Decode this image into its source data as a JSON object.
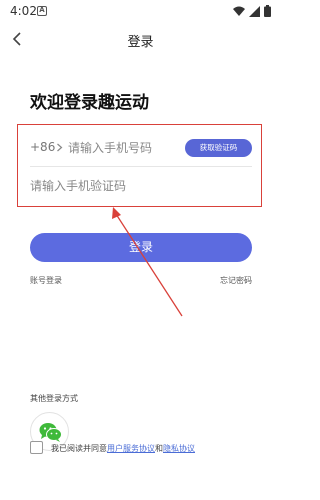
{
  "status_bar": {
    "time": "4:02",
    "notification_letter": "A",
    "icons": [
      "wifi-icon",
      "signal-icon",
      "battery-icon"
    ]
  },
  "nav": {
    "title": "登录",
    "back_icon": "chevron-left-icon"
  },
  "welcome_title": "欢迎登录趣运动",
  "phone_field": {
    "country_code": "+86",
    "placeholder": "请输入手机号码",
    "value": ""
  },
  "get_code_button": "获取验证码",
  "code_field": {
    "placeholder": "请输入手机验证码",
    "value": ""
  },
  "login_button": "登录",
  "account_login_link": "账号登录",
  "forgot_password_link": "忘记密码",
  "other_login_label": "其他登录方式",
  "other_login_methods": [
    "wechat-icon"
  ],
  "agreement": {
    "prefix": "我已阅读并同意",
    "user_agreement": "用户服务协议",
    "joiner": "和",
    "privacy_policy": "隐私协议",
    "checked": false
  },
  "colors": {
    "primary": "#5c6be0",
    "highlight_box": "#d9413a",
    "link": "#4a6cd6",
    "wechat": "#3fb93a"
  }
}
